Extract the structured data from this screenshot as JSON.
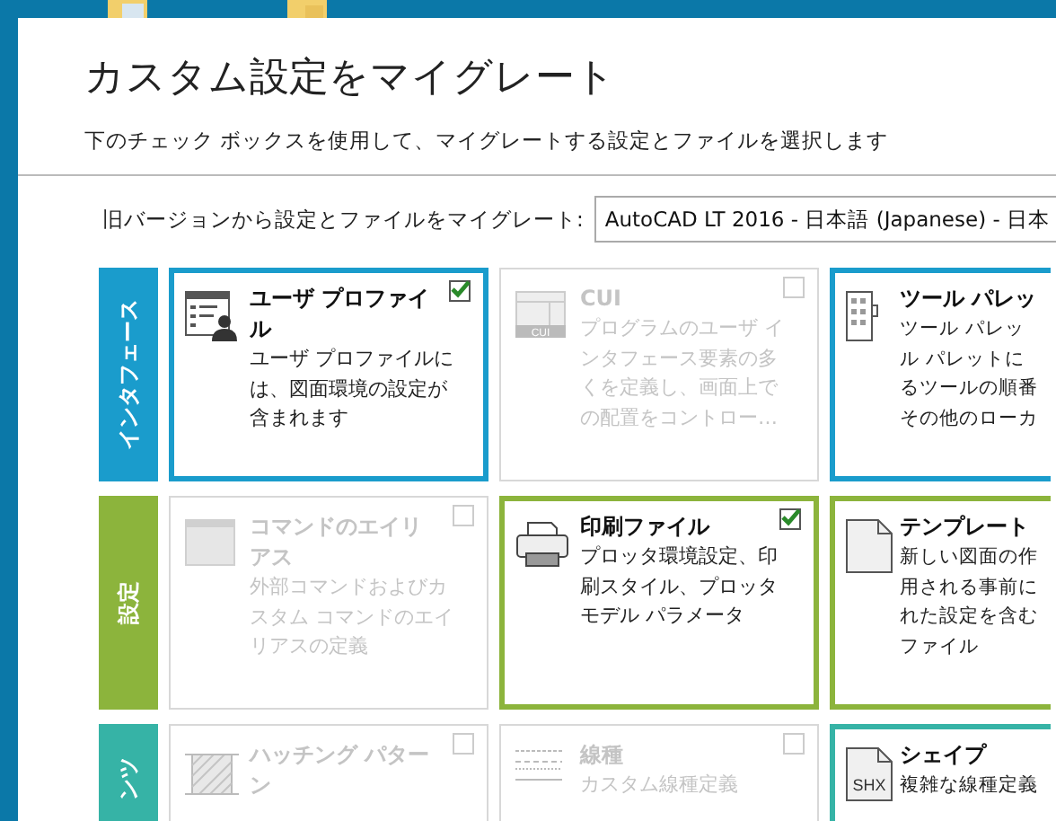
{
  "dialog": {
    "title": "カスタム設定をマイグレート",
    "subtitle": "下のチェック ボックスを使用して、マイグレートする設定とファイルを選択します",
    "version_label": "旧バージョンから設定とファイルをマイグレート:",
    "version_value": "AutoCAD LT 2016 - 日本語 (Japanese) - 日本"
  },
  "categories": [
    {
      "label": "インタフェース",
      "color": "#1a9ccc",
      "cards": [
        {
          "kind": "profile",
          "title": [
            "ユーザ プロファイ",
            "ル"
          ],
          "desc": [
            "ユーザ プロファイルに",
            "は、図面環境の設定が",
            "含まれます"
          ],
          "disabled": false,
          "checked": true
        },
        {
          "kind": "cui",
          "icon_text": "CUI",
          "title": [
            "CUI"
          ],
          "desc": [
            "プログラムのユーザ イ",
            "ンタフェース要素の多",
            "くを定義し、画面上で",
            "の配置をコントロー…"
          ],
          "disabled": true,
          "checked": false
        },
        {
          "kind": "palette",
          "title": [
            "ツール パレッ"
          ],
          "desc": [
            "ツール パレッ",
            "ル パレットに",
            "るツールの順番",
            "その他のローカ"
          ],
          "disabled": false
        }
      ]
    },
    {
      "label": "設定",
      "color": "#8cb43c",
      "cards": [
        {
          "kind": "command",
          "title": [
            "コマンドのエイリ",
            "アス"
          ],
          "desc": [
            "外部コマンドおよびカ",
            "スタム コマンドのエイ",
            "リアスの定義"
          ],
          "disabled": true,
          "checked": false
        },
        {
          "kind": "print",
          "title": [
            "印刷ファイル"
          ],
          "desc": [
            "プロッタ環境設定、印",
            "刷スタイル、プロッタ",
            "モデル パラメータ"
          ],
          "disabled": false,
          "checked": true
        },
        {
          "kind": "template",
          "title": [
            "テンプレート"
          ],
          "desc": [
            "新しい図面の作",
            "用される事前に",
            "れた設定を含む",
            "ファイル"
          ],
          "disabled": false
        }
      ]
    },
    {
      "label": "ンツ",
      "color": "#36b3a6",
      "cards": [
        {
          "kind": "hatch",
          "title": [
            "ハッチング パター",
            "ン"
          ],
          "disabled": true,
          "checked": false
        },
        {
          "kind": "linetype",
          "title": [
            "線種"
          ],
          "desc": [
            "カスタム線種定義"
          ],
          "disabled": true,
          "checked": false
        },
        {
          "kind": "shx",
          "icon_text": "SHX",
          "title": [
            "シェイプ"
          ],
          "desc": [
            "複雑な線種定義"
          ],
          "disabled": false
        }
      ]
    }
  ]
}
